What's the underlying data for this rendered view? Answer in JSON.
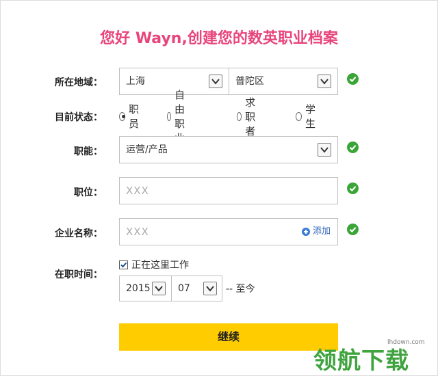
{
  "title": "您好 Wayn,创建您的数英职业档案",
  "location": {
    "label": "所在地域：",
    "city": "上海",
    "district": "普陀区"
  },
  "status": {
    "label": "目前状态：",
    "options": [
      "职员",
      "自由职业",
      "求职者",
      "学生"
    ],
    "selected": "职员"
  },
  "function": {
    "label": "职能：",
    "value": "运营/产品"
  },
  "position": {
    "label": "职位：",
    "placeholder": "XXX"
  },
  "company": {
    "label": "企业名称：",
    "placeholder": "XXX",
    "add_label": "添加"
  },
  "tenure": {
    "label": "在职时间：",
    "currently_working_label": "正在这里工作",
    "currently_working": true,
    "year": "2015",
    "month": "07",
    "to_now": "-- 至今"
  },
  "continue_label": "继续",
  "watermark": {
    "site": "lhdown.com",
    "text": "领航下载"
  },
  "colors": {
    "title": "#e8457b",
    "button": "#ffcc00",
    "check_ok": "#3aa537"
  }
}
